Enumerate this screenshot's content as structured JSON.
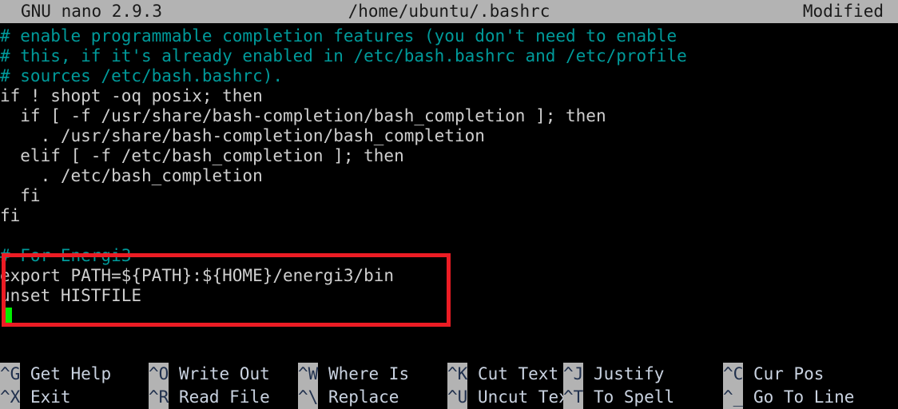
{
  "titlebar": {
    "version": "GNU nano 2.9.3",
    "filepath": "/home/ubuntu/.bashrc",
    "state": "Modified"
  },
  "colors": {
    "titlebar_bg": "#b3b3b3",
    "titlebar_fg": "#1a1a1a",
    "editor_bg": "#000000",
    "code_fg": "#cfcfcf",
    "comment_fg": "#009a9a",
    "cursor": "#00ef00",
    "annotation_red": "#ec1c24",
    "help_key_bg": "#b3b3b3",
    "help_label_fg": "#c9d2e0"
  },
  "editor": {
    "lines": [
      {
        "text": "# enable programmable completion features (you don't need to enable",
        "kind": "comment"
      },
      {
        "text": "# this, if it's already enabled in /etc/bash.bashrc and /etc/profile",
        "kind": "comment"
      },
      {
        "text": "# sources /etc/bash.bashrc).",
        "kind": "comment"
      },
      {
        "text": "if ! shopt -oq posix; then",
        "kind": "code"
      },
      {
        "text": "  if [ -f /usr/share/bash-completion/bash_completion ]; then",
        "kind": "code"
      },
      {
        "text": "    . /usr/share/bash-completion/bash_completion",
        "kind": "code"
      },
      {
        "text": "  elif [ -f /etc/bash_completion ]; then",
        "kind": "code"
      },
      {
        "text": "    . /etc/bash_completion",
        "kind": "code"
      },
      {
        "text": "  fi",
        "kind": "code"
      },
      {
        "text": "fi",
        "kind": "code"
      },
      {
        "text": "",
        "kind": "code"
      },
      {
        "text": "# For Energi3",
        "kind": "comment"
      },
      {
        "text": "export PATH=${PATH}:${HOME}/energi3/bin",
        "kind": "code"
      },
      {
        "text": "unset HISTFILE",
        "kind": "code"
      },
      {
        "text": "",
        "kind": "code"
      }
    ],
    "cursor": {
      "line_index": 14,
      "column": 0
    }
  },
  "annotation": {
    "label": "highlight-box",
    "color": "#ec1c24",
    "encloses": [
      "# For Energi3",
      "export PATH=${PATH}:${HOME}/energi3/bin",
      "unset HISTFILE"
    ]
  },
  "helpbar": {
    "rows": [
      [
        {
          "key": "^G",
          "label": "Get Help"
        },
        {
          "key": "^O",
          "label": "Write Out"
        },
        {
          "key": "^W",
          "label": "Where Is"
        },
        {
          "key": "^K",
          "label": "Cut Text"
        },
        {
          "key": "^J",
          "label": "Justify"
        },
        {
          "key": "^C",
          "label": "Cur Pos"
        }
      ],
      [
        {
          "key": "^X",
          "label": "Exit"
        },
        {
          "key": "^R",
          "label": "Read File"
        },
        {
          "key": "^\\",
          "label": "Replace"
        },
        {
          "key": "^U",
          "label": "Uncut Text"
        },
        {
          "key": "^T",
          "label": "To Spell"
        },
        {
          "key": "^_",
          "label": "Go To Line"
        }
      ]
    ]
  }
}
